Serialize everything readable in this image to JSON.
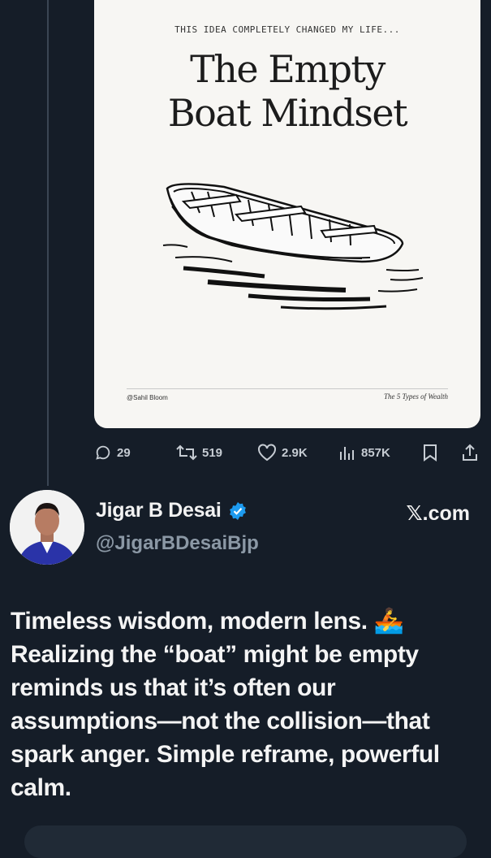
{
  "card": {
    "kicker": "THIS IDEA COMPLETELY CHANGED MY LIFE...",
    "title_line1": "The Empty",
    "title_line2": "Boat Mindset",
    "credit": "@Sahil Bloom",
    "book": "The 5 Types of Wealth"
  },
  "actions": {
    "replies": "29",
    "reposts": "519",
    "likes": "2.9K",
    "views": "857K"
  },
  "reply": {
    "name": "Jigar B Desai",
    "handle": "@JigarBDesaiBjp",
    "source": "𝕏.com",
    "text": "Timeless wisdom, modern lens. 🚣 Realizing the “boat” might be empty reminds us that it’s often our assumptions—not the collision—that spark anger. Simple reframe, powerful calm."
  },
  "colors": {
    "background": "#151d28",
    "verified": "#1d9bf0",
    "muted": "#8b98a5"
  }
}
